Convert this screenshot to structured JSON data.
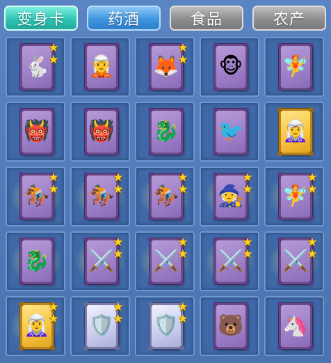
{
  "tabs": [
    {
      "label": "变身卡",
      "state": "active"
    },
    {
      "label": "药酒",
      "state": "blue"
    },
    {
      "label": "食品",
      "state": "gray"
    },
    {
      "label": "农产",
      "state": "gray"
    }
  ],
  "colors": {
    "background": "#4f79b6",
    "active_tab": "#2fc3b4",
    "star": "#ffd21e",
    "card_purple": "#9d7fc7",
    "card_gold": "#f7c33d",
    "card_silver": "#c9cdee"
  },
  "grid": [
    [
      {
        "icon": "rabbit-spirit-card",
        "glyph": "🐇",
        "frame": "purple",
        "stars": 2,
        "glow": false
      },
      {
        "icon": "warrior-card",
        "glyph": "🧝",
        "frame": "purple",
        "stars": 0,
        "glow": false
      },
      {
        "icon": "fox-spirit-card",
        "glyph": "🦊",
        "frame": "purple",
        "stars": 2,
        "glow": false
      },
      {
        "icon": "monkey-spirit-card",
        "glyph": "🐵",
        "frame": "purple",
        "stars": 0,
        "glow": false
      },
      {
        "icon": "fairy-card",
        "glyph": "🧚",
        "frame": "purple",
        "stars": 0,
        "glow": false
      }
    ],
    [
      {
        "icon": "demon-card",
        "glyph": "👹",
        "frame": "purple",
        "stars": 0,
        "glow": false
      },
      {
        "icon": "demon-card",
        "glyph": "👹",
        "frame": "purple",
        "stars": 0,
        "glow": false
      },
      {
        "icon": "dragon-card",
        "glyph": "🐉",
        "frame": "purple",
        "stars": 0,
        "glow": false
      },
      {
        "icon": "phoenix-card",
        "glyph": "🐦",
        "frame": "purple",
        "stars": 0,
        "glow": false
      },
      {
        "icon": "goddess-card",
        "glyph": "🧝‍♀️",
        "frame": "gold",
        "stars": 0,
        "glow": false
      }
    ],
    [
      {
        "icon": "rider-card",
        "glyph": "🏇",
        "frame": "purple",
        "stars": 2,
        "glow": true
      },
      {
        "icon": "rider-card",
        "glyph": "🏇",
        "frame": "purple",
        "stars": 2,
        "glow": true
      },
      {
        "icon": "rider-card",
        "glyph": "🏇",
        "frame": "purple",
        "stars": 2,
        "glow": true
      },
      {
        "icon": "sage-card",
        "glyph": "🧙",
        "frame": "purple",
        "stars": 2,
        "glow": true
      },
      {
        "icon": "fairy-card",
        "glyph": "🧚",
        "frame": "purple",
        "stars": 2,
        "glow": true
      }
    ],
    [
      {
        "icon": "dragon-card",
        "glyph": "🐉",
        "frame": "purple",
        "stars": 0,
        "glow": true
      },
      {
        "icon": "general-card",
        "glyph": "⚔️",
        "frame": "purple",
        "stars": 2,
        "glow": true
      },
      {
        "icon": "general-card",
        "glyph": "⚔️",
        "frame": "purple",
        "stars": 2,
        "glow": true
      },
      {
        "icon": "general-card",
        "glyph": "⚔️",
        "frame": "purple",
        "stars": 2,
        "glow": true
      },
      {
        "icon": "general-card",
        "glyph": "⚔️",
        "frame": "purple",
        "stars": 2,
        "glow": true
      }
    ],
    [
      {
        "icon": "goddess-card",
        "glyph": "🧝‍♀️",
        "frame": "gold",
        "stars": 2,
        "glow": true
      },
      {
        "icon": "knight-card",
        "glyph": "🛡️",
        "frame": "silver",
        "stars": 2,
        "glow": false
      },
      {
        "icon": "knight-card",
        "glyph": "🛡️",
        "frame": "silver",
        "stars": 2,
        "glow": false
      },
      {
        "icon": "beast-card",
        "glyph": "🐻",
        "frame": "purple",
        "stars": 0,
        "glow": false
      },
      {
        "icon": "beast-rider-card",
        "glyph": "🦄",
        "frame": "purple",
        "stars": 0,
        "glow": false
      }
    ]
  ]
}
